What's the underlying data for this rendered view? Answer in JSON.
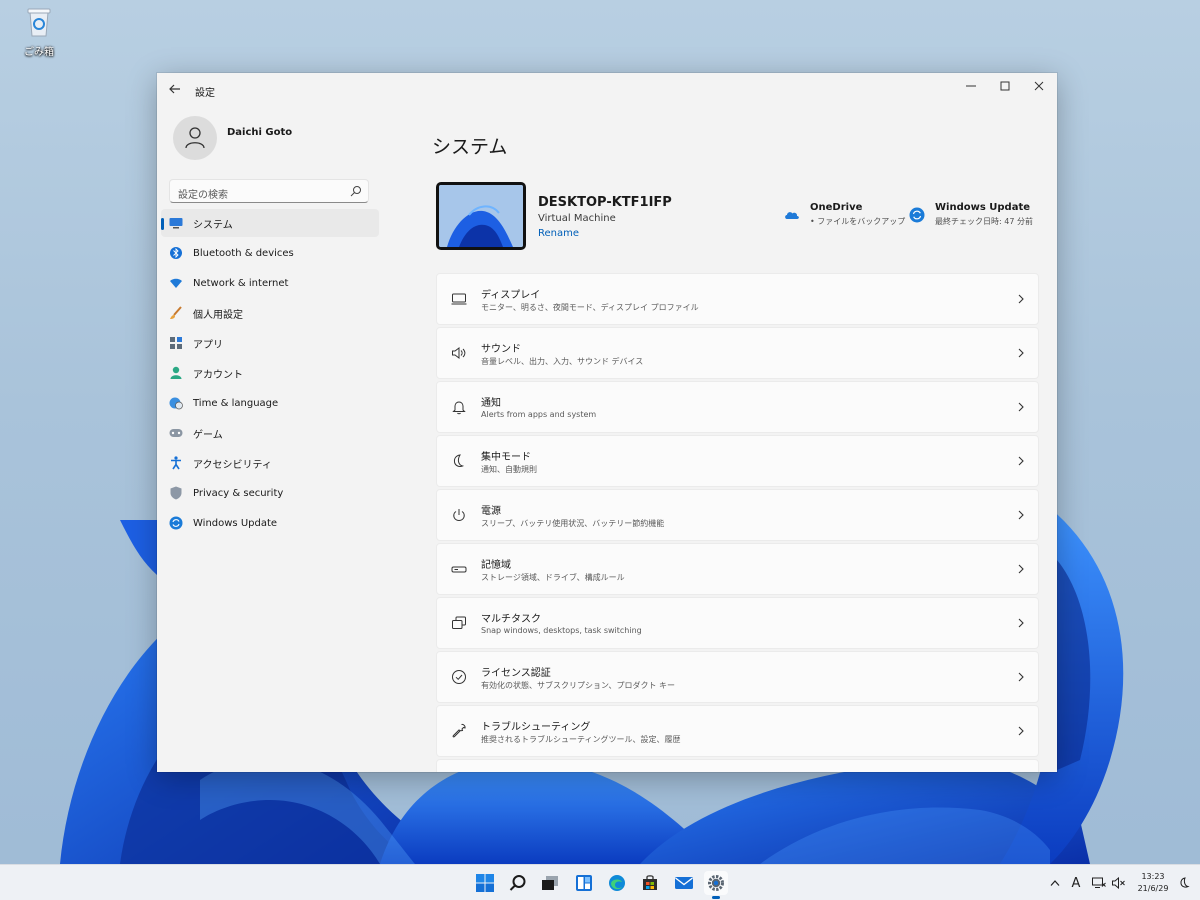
{
  "desktop": {
    "recycle_bin_label": "ごみ箱"
  },
  "window": {
    "app_title": "設定",
    "icons": {
      "back": "arrow-left-icon",
      "minimize": "minimize-icon",
      "maximize": "maximize-icon",
      "close": "close-icon"
    }
  },
  "sidebar": {
    "user_name": "Daichi Goto",
    "search_placeholder": "設定の検索",
    "items": [
      {
        "label": "システム",
        "icon": "monitor-icon",
        "active": true
      },
      {
        "label": "Bluetooth & devices",
        "icon": "bluetooth-icon"
      },
      {
        "label": "Network & internet",
        "icon": "wifi-icon"
      },
      {
        "label": "個人用設定",
        "icon": "brush-icon"
      },
      {
        "label": "アプリ",
        "icon": "apps-icon"
      },
      {
        "label": "アカウント",
        "icon": "person-icon"
      },
      {
        "label": "Time & language",
        "icon": "globe-clock-icon"
      },
      {
        "label": "ゲーム",
        "icon": "gamepad-icon"
      },
      {
        "label": "アクセシビリティ",
        "icon": "accessibility-icon"
      },
      {
        "label": "Privacy & security",
        "icon": "shield-icon"
      },
      {
        "label": "Windows Update",
        "icon": "update-icon"
      }
    ]
  },
  "main": {
    "page_title": "システム",
    "device": {
      "name": "DESKTOP-KTF1IFP",
      "type": "Virtual Machine",
      "rename": "Rename"
    },
    "onedrive": {
      "title": "OneDrive",
      "subtitle": "• ファイルをバックアップ"
    },
    "windows_update": {
      "title": "Windows Update",
      "subtitle": "最終チェック日時: 47 分前"
    },
    "settings": [
      {
        "title": "ディスプレイ",
        "subtitle": "モニター、明るさ、夜間モード、ディスプレイ プロファイル",
        "icon": "display-icon"
      },
      {
        "title": "サウンド",
        "subtitle": "音量レベル、出力、入力、サウンド デバイス",
        "icon": "speaker-icon"
      },
      {
        "title": "通知",
        "subtitle": "Alerts from apps and system",
        "icon": "bell-icon"
      },
      {
        "title": "集中モード",
        "subtitle": "通知、自動規則",
        "icon": "moon-icon"
      },
      {
        "title": "電源",
        "subtitle": "スリープ、バッテリ使用状況、バッテリー節約機能",
        "icon": "power-icon"
      },
      {
        "title": "記憶域",
        "subtitle": "ストレージ領域、ドライブ、構成ルール",
        "icon": "storage-icon"
      },
      {
        "title": "マルチタスク",
        "subtitle": "Snap windows, desktops, task switching",
        "icon": "multitask-icon"
      },
      {
        "title": "ライセンス認証",
        "subtitle": "有効化の状態、サブスクリプション、プロダクト キー",
        "icon": "check-circle-icon"
      },
      {
        "title": "トラブルシューティング",
        "subtitle": "推奨されるトラブルシューティングツール、設定、履歴",
        "icon": "wrench-icon"
      }
    ]
  },
  "taskbar": {
    "apps": [
      "start-icon",
      "search-icon",
      "task-view-icon",
      "widgets-icon",
      "edge-icon",
      "store-icon",
      "mail-icon",
      "settings-icon"
    ],
    "active_app": "settings-icon",
    "tray_ime": "A",
    "clock_time": "13:23",
    "clock_date": "21/6/29"
  },
  "colors": {
    "accent": "#005fb8",
    "window_bg": "#f3f3f3",
    "card_bg": "#fbfbfb",
    "wallpaper_blue": "#1a5fe0"
  }
}
